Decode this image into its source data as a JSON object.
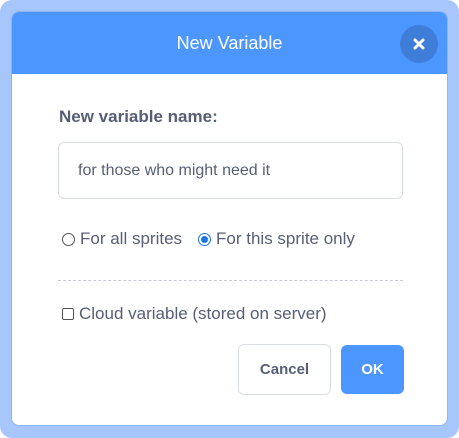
{
  "dialog": {
    "title": "New Variable",
    "close_icon": "close-icon"
  },
  "form": {
    "name_label": "New variable name:",
    "name_value": "for those who might need it",
    "scope_options": [
      {
        "label": "For all sprites",
        "checked": false
      },
      {
        "label": "For this sprite only",
        "checked": true
      }
    ],
    "cloud_label": "Cloud variable (stored on server)",
    "cloud_checked": false
  },
  "buttons": {
    "cancel": "Cancel",
    "ok": "OK"
  },
  "colors": {
    "accent": "#4c97ff",
    "text": "#575e75",
    "frame": "#a7c6fb"
  }
}
